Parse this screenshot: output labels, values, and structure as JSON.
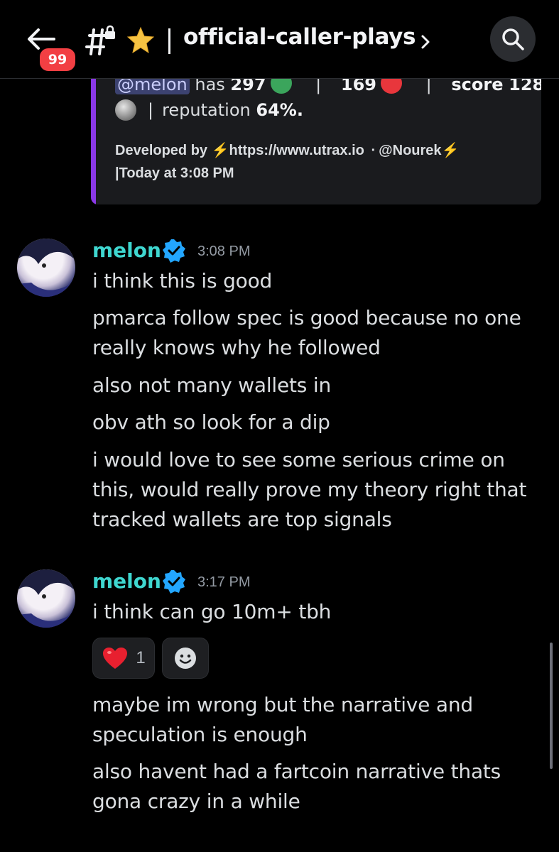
{
  "header": {
    "unread_badge": "99",
    "channel_name": "official-caller-plays",
    "back_icon": "arrow-left-icon",
    "channel_icon": "locked-hashtag-icon",
    "favorite_icon": "star-icon",
    "search_icon": "search-icon"
  },
  "embed": {
    "mention": "@melon",
    "has_text": "has",
    "green_count": "297",
    "red_count": "169",
    "score_label": "score",
    "score_value": "128",
    "reputation_label": "reputation",
    "reputation_value": "64%.",
    "footer_developed": "Developed by",
    "footer_url": "https://www.utrax.io",
    "footer_author": "@Nourek",
    "footer_time": "Today at 3:08 PM",
    "accent_color": "#8a38e6"
  },
  "messages": [
    {
      "username": "melon",
      "time": "3:08 PM",
      "lines": [
        "i think this is good",
        "pmarca follow spec is good because no one really knows why he followed",
        "also not many wallets in",
        "obv ath so look for a dip",
        "i would love to see some serious crime on this, would really prove my theory right that tracked wallets are top signals"
      ]
    },
    {
      "username": "melon",
      "time": "3:17 PM",
      "lines": [
        "i think can go 10m+ tbh",
        "maybe im wrong but the narrative and speculation is enough",
        "also havent had a fartcoin narrative thats gona crazy in a while"
      ],
      "reaction": {
        "emoji": "❤️",
        "count": "1"
      }
    }
  ]
}
